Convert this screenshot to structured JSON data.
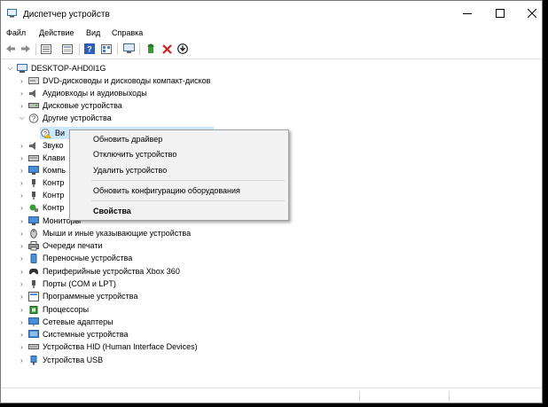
{
  "window": {
    "title": "Диспетчер устройств"
  },
  "menu": {
    "file": "Файл",
    "action": "Действие",
    "view": "Вид",
    "help": "Справка"
  },
  "tree": {
    "root": "DESKTOP-AHD0I1G",
    "items": [
      "DVD-дисководы и дисководы компакт-дисков",
      "Аудиовходы и аудиовыходы",
      "Дисковые устройства",
      "Другие устройства",
      "Ви",
      "Звуко",
      "Клави",
      "Компь",
      "Контр",
      "Контр",
      "Контр",
      "Мониторы",
      "Мыши и иные указывающие устройства",
      "Очереди печати",
      "Переносные устройства",
      "Периферийные устройства Xbox 360",
      "Порты (COM и LPT)",
      "Программные устройства",
      "Процессоры",
      "Сетевые адаптеры",
      "Системные устройства",
      "Устройства HID (Human Interface Devices)",
      "Устройства USB"
    ]
  },
  "context_menu": {
    "update_driver": "Обновить драйвер",
    "disable_device": "Отключить устройство",
    "uninstall_device": "Удалить устройство",
    "scan_hardware": "Обновить конфигурацию оборудования",
    "properties": "Свойства"
  },
  "colors": {
    "selection": "#cce8ff",
    "menu_bg": "#f2f2f2",
    "remove_red": "#d11f1f",
    "help_blue": "#2f5fb7"
  }
}
